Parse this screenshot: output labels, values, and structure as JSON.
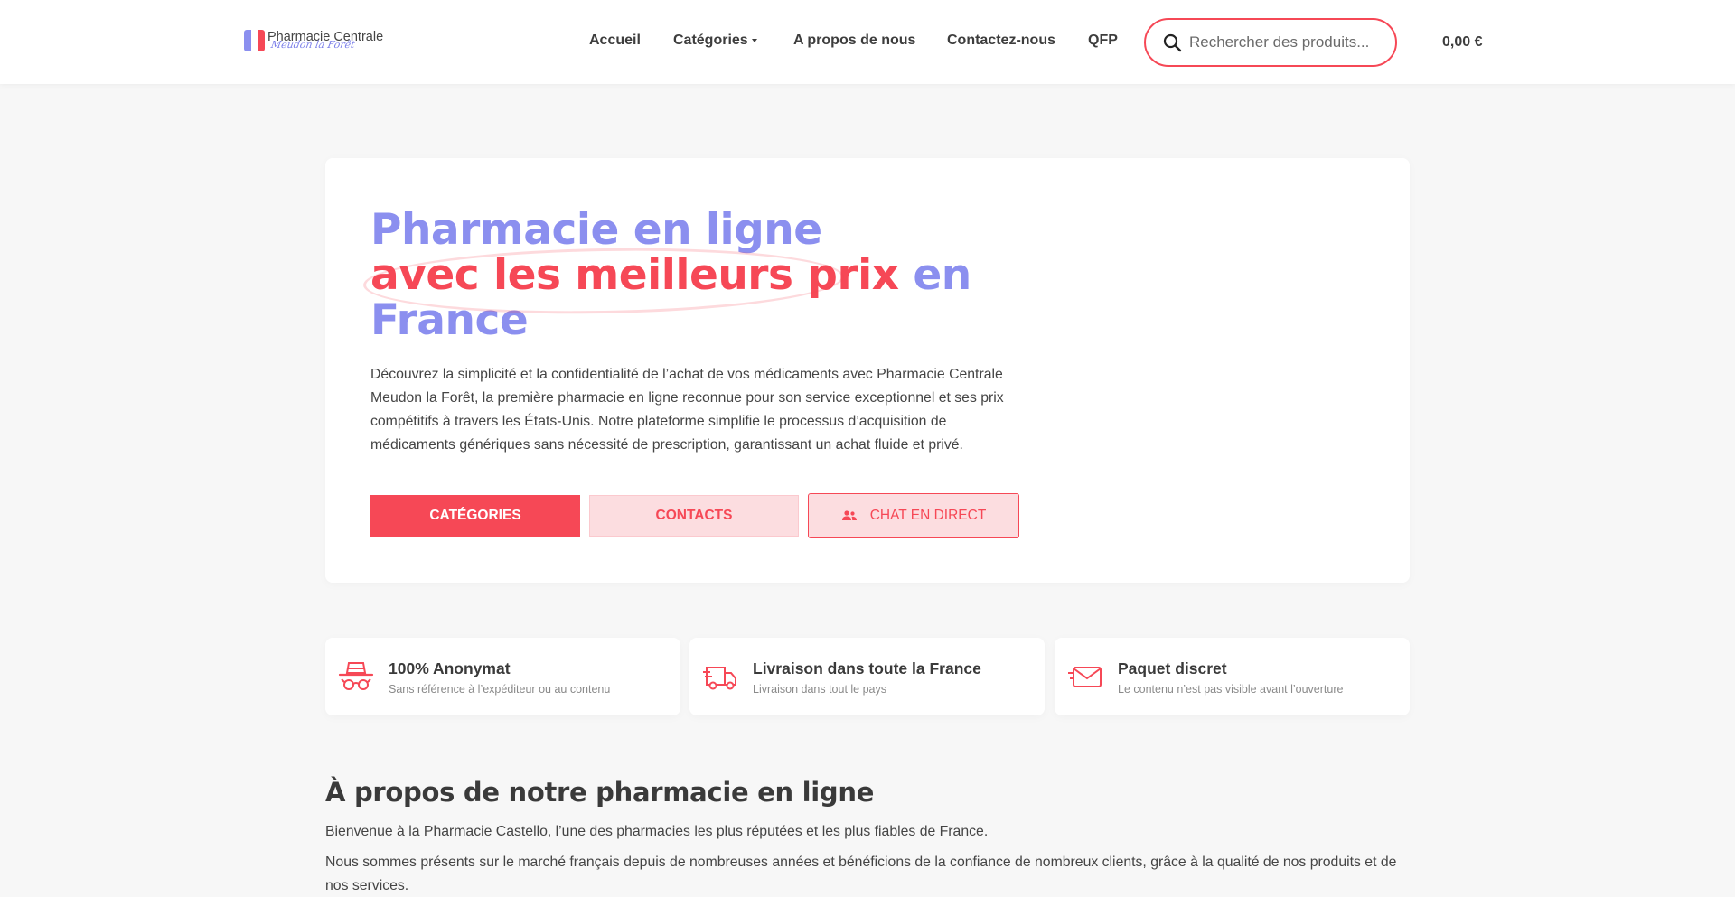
{
  "brand": {
    "name": "Pharmacie Centrale",
    "subtitle": "Meudon la Forêt",
    "flag_colors": [
      "#8b8fef",
      "#ffffff",
      "#f64856"
    ]
  },
  "nav": {
    "items": [
      {
        "label": "Accueil"
      },
      {
        "label": "Catégories",
        "has_dropdown": true
      },
      {
        "label": "A propos de nous"
      },
      {
        "label": "Contactez-nous"
      },
      {
        "label": "QFP"
      }
    ]
  },
  "search": {
    "placeholder": "Rechercher des produits...",
    "value": ""
  },
  "cart": {
    "total": "0,00 €"
  },
  "hero": {
    "title_line1": "Pharmacie en ligne",
    "title_highlight": "avec les meilleurs prix",
    "title_after": " en",
    "title_line3": "France",
    "description": "Découvrez la simplicité et la confidentialité de l’achat de vos médicaments avec Pharmacie Centrale Meudon la Forêt, la première pharmacie en ligne reconnue pour son service exceptionnel et ses prix compétitifs à travers les États-Unis. Notre plateforme simplifie le processus d’acquisition de médicaments génériques sans nécessité de prescription, garantissant un achat fluide et privé.",
    "buttons": {
      "categories": "CATÉGORIES",
      "contacts": "CONTACTS",
      "chat": "CHAT EN DIRECT"
    }
  },
  "features": [
    {
      "title": "100% Anonymat",
      "subtitle": "Sans référence à l’expéditeur ou au contenu",
      "icon": "incognito-icon"
    },
    {
      "title": "Livraison dans toute la France",
      "subtitle": "Livraison dans tout le pays",
      "icon": "delivery-truck-icon"
    },
    {
      "title": "Paquet discret",
      "subtitle": "Le contenu n’est pas visible avant l’ouverture",
      "icon": "envelope-icon"
    }
  ],
  "about": {
    "title": "À propos de notre pharmacie en ligne",
    "paragraphs": [
      "Bienvenue à la Pharmacie Castello, l’une des pharmacies les plus réputées et les plus fiables de France.",
      "Nous sommes présents sur le marché français depuis de nombreuses années et bénéficions de la confiance de nombreux clients, grâce à la qualité de nos produits et de nos services."
    ]
  },
  "colors": {
    "accent": "#f64856",
    "brand_purple": "#8b8fef",
    "background": "#f7f7f7"
  }
}
